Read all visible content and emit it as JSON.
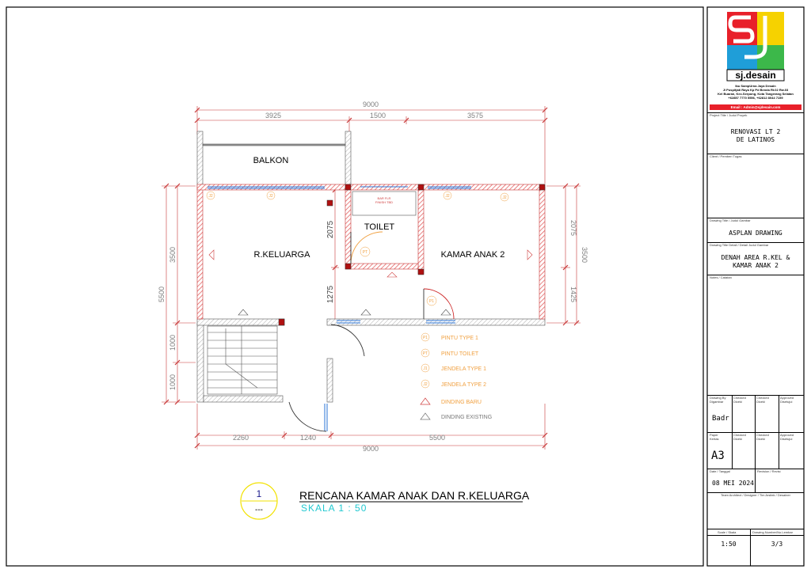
{
  "plan": {
    "rooms": {
      "balkon": "BALKON",
      "keluarga": "R.KELUARGA",
      "toilet": "TOILET",
      "kamar": "KAMAR ANAK 2"
    },
    "toilet_note": [
      "BAR FLR",
      "FINISH TBD"
    ],
    "dims": {
      "top_total": "9000",
      "top_a": "3925",
      "top_b": "1500",
      "top_c": "3575",
      "bottom_a": "2260",
      "bottom_b": "1240",
      "bottom_c": "5500",
      "bottom_total": "9000",
      "left_total": "5500",
      "left_a": "3500",
      "left_b": "1000",
      "left_c": "1000",
      "mid_a": "2075",
      "mid_b": "1275",
      "right_a": "2075",
      "right_b": "1425",
      "right_total": "3500"
    },
    "tags": {
      "j2": "J2",
      "p1": "P1",
      "pt": "PT",
      "j1": "J1"
    },
    "legend": [
      {
        "tag": "P1",
        "text": "PINTU TYPE 1"
      },
      {
        "tag": "PT",
        "text": "PINTU TOILET"
      },
      {
        "tag": "J1",
        "text": "JENDELA TYPE 1"
      },
      {
        "tag": "J2",
        "text": "JENDELA TYPE 2"
      },
      {
        "tag": "",
        "text": "DINDING BARU"
      },
      {
        "tag": "",
        "text": "DINDING EXISTING"
      }
    ],
    "title_block": {
      "number": "1",
      "sub": "---",
      "title": "RENCANA KAMAR ANAK DAN R.KELUARGA",
      "scale": "SKALA    1 : 50"
    }
  },
  "titleblock": {
    "brand": "sj.desain",
    "company": "Ibu SampUrna Jaya Desain",
    "address1": "Jl Puspitjati Raya Kp Pd Benda Rt.02 Rw.03",
    "address2": "Kel Buaran, Kec.Serpong, Kota Tangerang Selatan",
    "phone": "+62857 7770 5556, +62812 8044 7159",
    "email": "Email : Admin@sjdesain.com",
    "project_label": "Project Title / Judul Proyek",
    "project": [
      "RENOVASI LT 2",
      "DE LATINOS"
    ],
    "client_label": "Client / Pemberi Tugas",
    "drawing_title_label": "Drawing Title / Judul Gambar",
    "drawing_title": "ASPLAN DRAWING",
    "drawing_detail_label": "Drawing Title Detail / Detail Judul Gambar",
    "drawing_detail": [
      "DENAH AREA R.KEL &",
      "KAMAR ANAK 2"
    ],
    "notes_label": "Notes / Catatan",
    "drawn_by_label": [
      "Drawing By",
      "Digambar"
    ],
    "checked1_label": [
      "Checked",
      "Diceki"
    ],
    "checked2_label": [
      "Checked",
      "Diceki"
    ],
    "approved_label": [
      "Approved",
      "Disetujui"
    ],
    "drawn_by": "Badr",
    "paper_label": [
      "Paper",
      "Kertas"
    ],
    "paper": "A3",
    "date_label": "Date / Tanggal",
    "revision_label": "Revision / Revisi",
    "date": "08 MEI 2024",
    "team_label": "Team Architect / Designer / Tim Arsitek / Desainer",
    "scale_label": "Scale / Skala",
    "number_label": "Drawing Number/No.Lembar",
    "scale": "1:50",
    "number": "3/3"
  },
  "colors": {
    "dim_line": "#c83737",
    "dim_text": "#7f7f7f",
    "wall_hatch": "#e05050",
    "window": "#2a73d6",
    "door": "#cc2222",
    "legend_tag": "#f0a040",
    "title_circle": "#f2e200",
    "scale_text": "#20c8d0",
    "logo_red": "#e8202a",
    "logo_yellow": "#f6d200",
    "logo_green": "#3cb84a",
    "logo_blue": "#1f9ed8"
  }
}
